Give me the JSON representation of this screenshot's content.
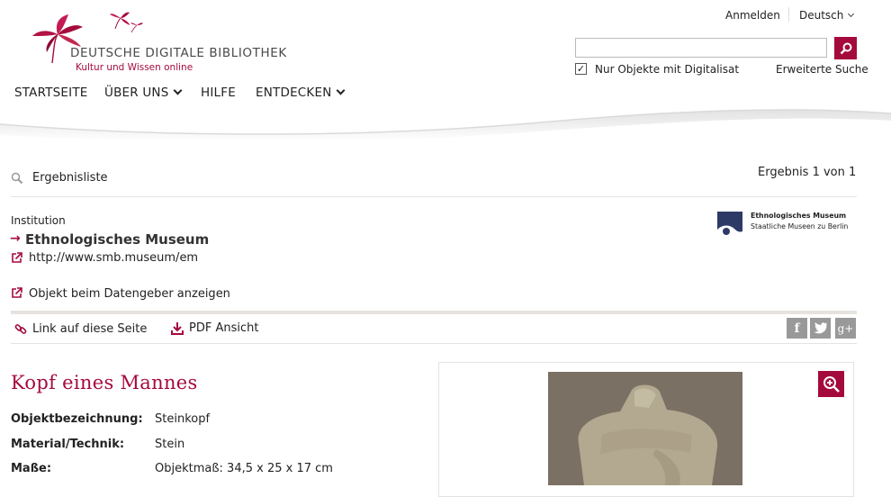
{
  "header": {
    "logo_title": "DEUTSCHE DIGITALE BIBLIOTHEK",
    "logo_subtitle": "Kultur und Wissen online",
    "login_label": "Anmelden",
    "language_label": "Deutsch",
    "search_placeholder": "",
    "digitalisat_checkbox_label": "Nur Objekte mit Digitalisat",
    "digitalisat_checked": true,
    "advanced_search_label": "Erweiterte Suche"
  },
  "nav": {
    "items": [
      {
        "label": "STARTSEITE",
        "has_dropdown": false
      },
      {
        "label": "ÜBER UNS",
        "has_dropdown": true
      },
      {
        "label": "HILFE",
        "has_dropdown": false
      },
      {
        "label": "ENTDECKEN",
        "has_dropdown": true
      }
    ]
  },
  "results": {
    "back_label": "Ergebnisliste",
    "counter": "Ergebnis 1 von 1"
  },
  "institution": {
    "heading": "Institution",
    "name": "Ethnologisches Museum",
    "url": "http://www.smb.museum/em",
    "provider_link": "Objekt beim Datengeber anzeigen",
    "logo_line1": "Ethnologisches Museum",
    "logo_line2": "Staatliche Museen zu Berlin"
  },
  "actions": {
    "link_label": "Link auf diese Seite",
    "pdf_label": "PDF Ansicht",
    "social": [
      "f",
      "t",
      "g+"
    ]
  },
  "object": {
    "title": "Kopf eines Mannes",
    "fields": [
      {
        "label": "Objektbezeichnung:",
        "value": "Steinkopf"
      },
      {
        "label": "Material/Technik:",
        "value": "Stein"
      },
      {
        "label": "Maße:",
        "value": "Objektmaß: 34,5 x 25 x 17 cm"
      }
    ]
  },
  "colors": {
    "brand": "#a50a3c",
    "social_gray": "#999999",
    "divider": "#e3e3e3"
  }
}
